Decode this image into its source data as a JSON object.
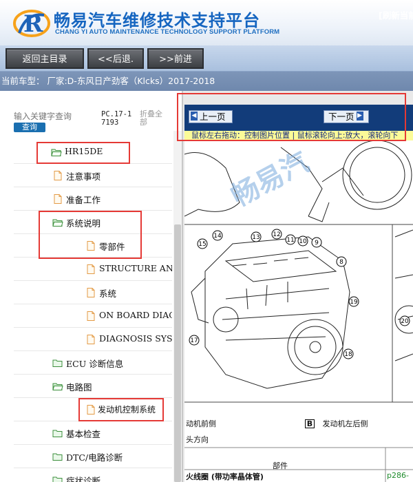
{
  "brand": {
    "title": "畅易汽车维修技术支持平台",
    "subtitle": "CHANG YI AUTO MAINTENANCE TECHNOLOGY SUPPORT PLATFORM",
    "logo_letter": "R",
    "logo_color": "#f7a21b"
  },
  "nav": {
    "home": "返回主目录",
    "back": "<<后退.",
    "forward": ">>前进"
  },
  "vehicle": {
    "line": "当前车型： 厂家:D-东风日产劲客（Klcks）2017-2018"
  },
  "search": {
    "placeholder": "输入关键字查询",
    "button": "查询",
    "code": "PC.17-17193",
    "collapse_all": "折叠全部"
  },
  "tree": {
    "items": [
      {
        "label": "HR15DE",
        "icon": "folder-open-icon"
      },
      {
        "label": "注意事项",
        "icon": "document-icon"
      },
      {
        "label": "准备工作",
        "icon": "document-icon"
      },
      {
        "label": "系统说明",
        "icon": "folder-open-icon"
      },
      {
        "label": "零部件",
        "icon": "document-icon"
      },
      {
        "label": "STRUCTURE AND OPERATION",
        "icon": "document-icon"
      },
      {
        "label": "系统",
        "icon": "document-icon"
      },
      {
        "label": "ON BOARD DIAGNOSTIC",
        "icon": "document-icon"
      },
      {
        "label": "DIAGNOSIS SYSTEM",
        "icon": "document-icon"
      },
      {
        "label": "ECU 诊断信息",
        "icon": "folder-closed-icon"
      },
      {
        "label": "电路图",
        "icon": "folder-open-icon"
      },
      {
        "label": "发动机控制系统",
        "icon": "document-icon"
      },
      {
        "label": "基本检查",
        "icon": "folder-closed-icon"
      },
      {
        "label": "DTC/电路诊断",
        "icon": "folder-closed-icon"
      },
      {
        "label": "症状诊断",
        "icon": "folder-closed-icon"
      }
    ]
  },
  "document": {
    "prev": "上一页",
    "next": "下一页",
    "refresh": "[刷新当前",
    "hint": "鼠标左右拖动：控制图片位置 | 鼠标滚轮向上:放大，滚轮向下",
    "watermark": "畅易汽",
    "caption_a": "动机前侧",
    "caption_b_badge": "B",
    "caption_b": "发动机左后侧",
    "direction": "头方向",
    "table_header": "部件",
    "table_row": "火线圈 (带功率晶体管)",
    "table_ref": "p286-",
    "callouts": [
      "15",
      "14",
      "13",
      "12",
      "11",
      "10",
      "9",
      "8",
      "19",
      "18",
      "17",
      "20"
    ]
  },
  "colors": {
    "brand_blue": "#1565c0",
    "highlight_red": "#e53935",
    "doc_bar": "#123c7a",
    "hint_bg": "#fbfb98"
  }
}
